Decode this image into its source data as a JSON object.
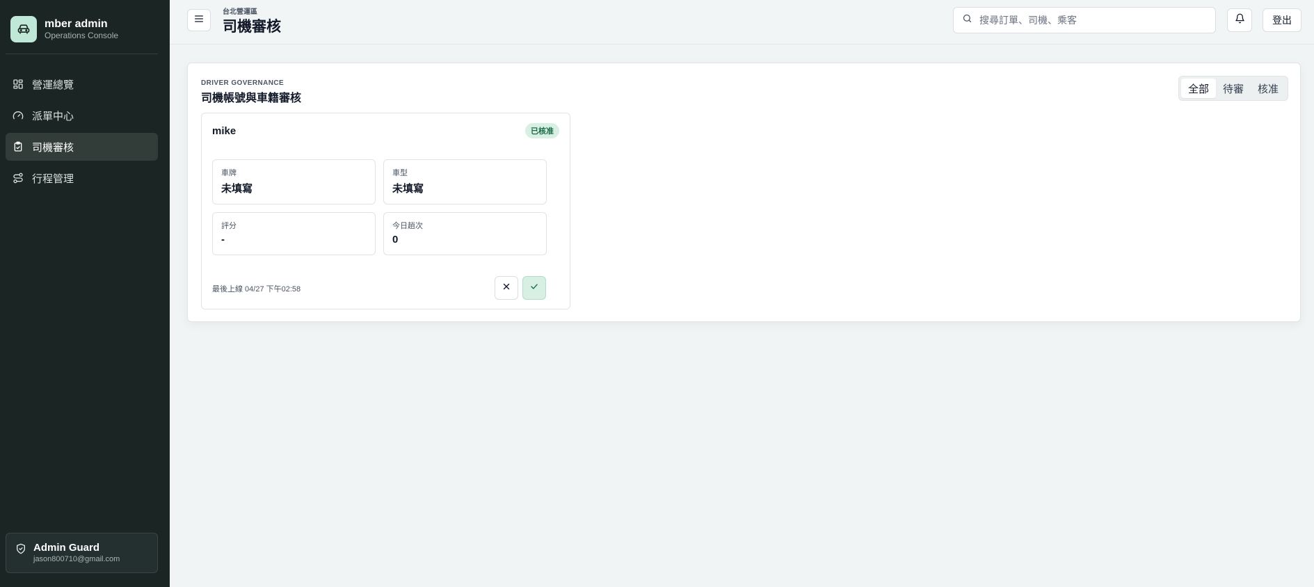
{
  "brand": {
    "name": "mber admin",
    "subtitle": "Operations Console"
  },
  "sidebar": {
    "items": [
      {
        "label": "營運總覽",
        "icon": "dashboard-grid-icon",
        "active": false
      },
      {
        "label": "派單中心",
        "icon": "gauge-icon",
        "active": false
      },
      {
        "label": "司機審核",
        "icon": "clipboard-check-icon",
        "active": true
      },
      {
        "label": "行程管理",
        "icon": "route-icon",
        "active": false
      }
    ]
  },
  "admin": {
    "name": "Admin Guard",
    "email": "jason800710@gmail.com",
    "icon": "shield-icon"
  },
  "header": {
    "breadcrumb": "台北營運區",
    "title": "司機審核",
    "search_placeholder": "搜尋訂單、司機、乘客",
    "logout_label": "登出"
  },
  "panel": {
    "eyebrow": "DRIVER GOVERNANCE",
    "title": "司機帳號與車籍審核",
    "filters": [
      {
        "label": "全部",
        "active": true
      },
      {
        "label": "待審",
        "active": false
      },
      {
        "label": "核准",
        "active": false
      }
    ]
  },
  "driver": {
    "name": "mike",
    "status": "已核准",
    "fields": {
      "plate": {
        "label": "車牌",
        "value": "未填寫"
      },
      "model": {
        "label": "車型",
        "value": "未填寫"
      },
      "rating": {
        "label": "評分",
        "value": "-"
      },
      "trips_today": {
        "label": "今日趟次",
        "value": "0"
      }
    },
    "last_online": "最後上線 04/27 下午02:58"
  },
  "colors": {
    "sidebar_bg": "#1b2523",
    "accent": "#bfe8d8",
    "badge_bg": "#d8efe4",
    "badge_text": "#1d6b46",
    "page_bg": "#f1f4f5"
  }
}
